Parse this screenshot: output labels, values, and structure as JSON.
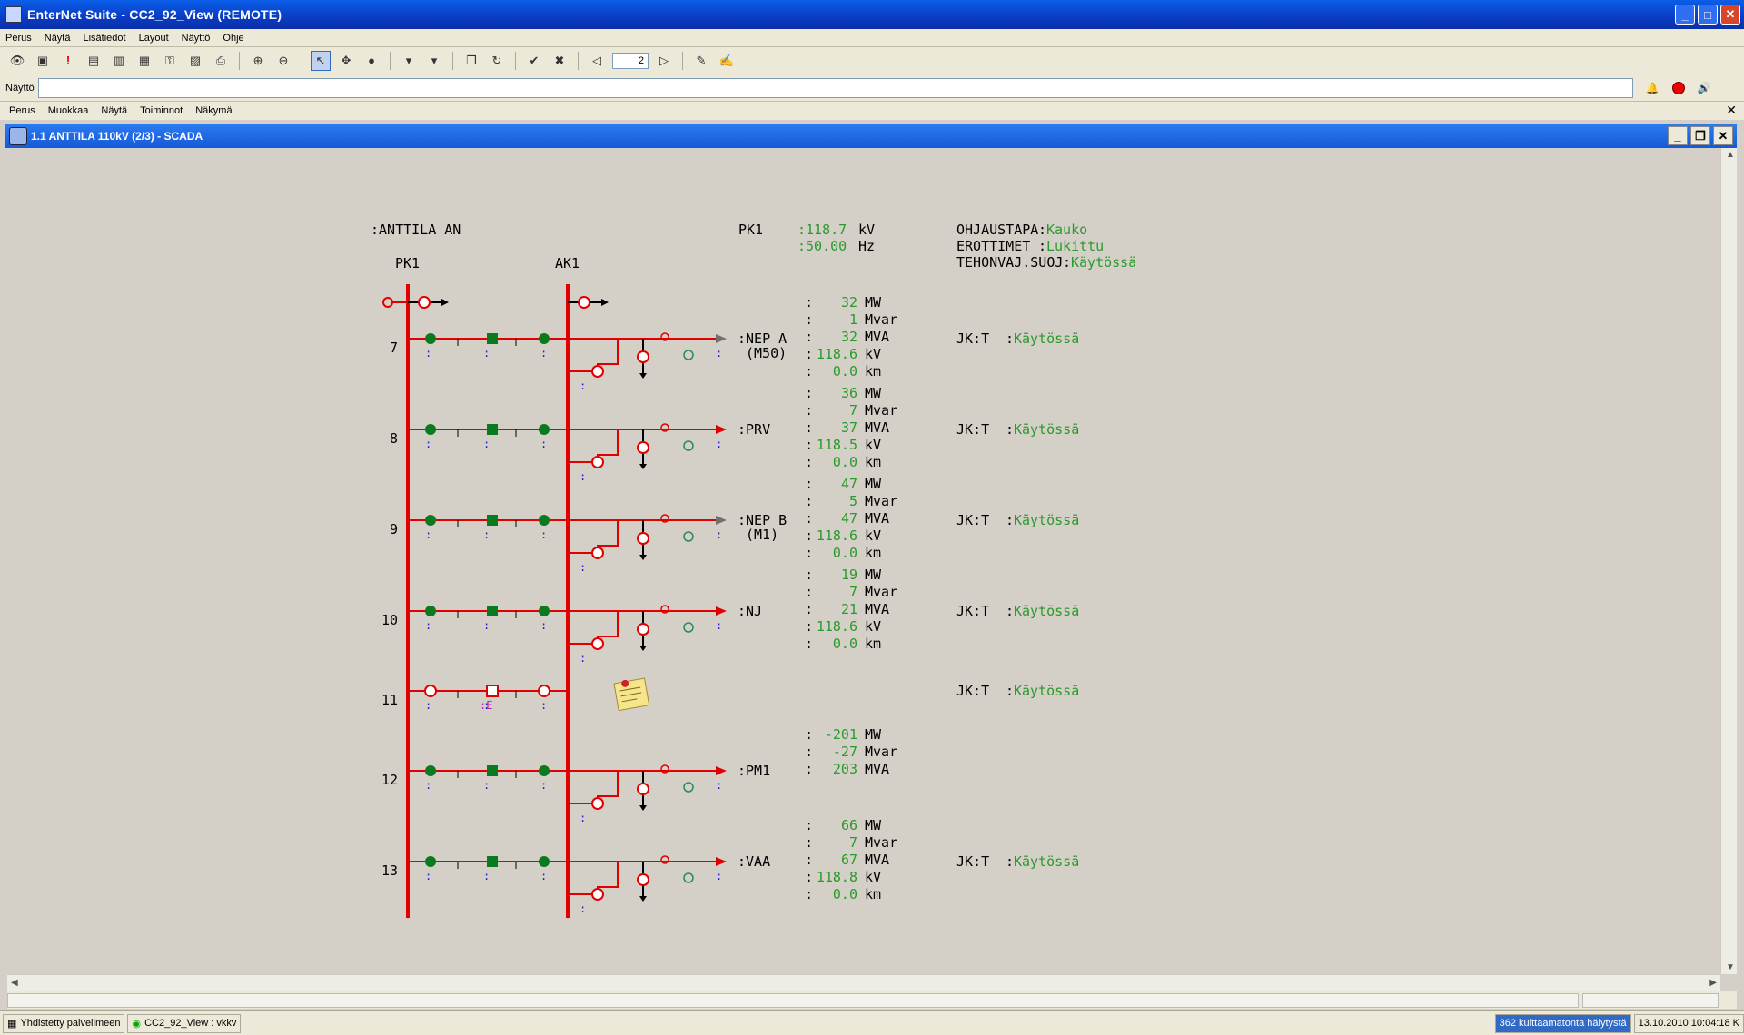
{
  "app": {
    "title": "EnterNet Suite  - CC2_92_View  (REMOTE)",
    "menu": [
      "Perus",
      "Näytä",
      "Lisätiedot",
      "Layout",
      "Näyttö",
      "Ohje"
    ],
    "command_label": "Näyttö",
    "command_value": "",
    "page_number": "2",
    "submenu": [
      "Perus",
      "Muokkaa",
      "Näytä",
      "Toiminnot",
      "Näkymä"
    ]
  },
  "child_window": {
    "title": "1.1 ANTTILA 110kV (2/3) - SCADA"
  },
  "scada": {
    "station": ":ANTTILA AN",
    "bus1": "PK1",
    "bus2": "AK1",
    "bus_meas_label": "PK1",
    "bus_kv": ":118.7",
    "bus_kv_unit": "kV",
    "bus_hz": ":50.00",
    "bus_hz_unit": "Hz",
    "status": [
      {
        "label": "OHJAUSTAPA",
        "sep": ":",
        "value": "Kauko"
      },
      {
        "label": "EROTTIMET ",
        "sep": ":",
        "value": "Lukittu"
      },
      {
        "label": "TEHONVAJ.SUOJ",
        "sep": ":",
        "value": "Käytössä"
      }
    ],
    "feeders": [
      {
        "num": "7",
        "name": ":NEP A",
        "name2": "(M50)",
        "mw": "32",
        "mvar": "1",
        "mva": "32",
        "kv": "118.6",
        "km": "0.0",
        "jkt": "Käytössä",
        "arrow": "gray"
      },
      {
        "num": "8",
        "name": ":PRV",
        "name2": "",
        "mw": "36",
        "mvar": "7",
        "mva": "37",
        "kv": "118.5",
        "km": "0.0",
        "jkt": "Käytössä",
        "arrow": "red"
      },
      {
        "num": "9",
        "name": ":NEP B",
        "name2": "(M1)",
        "mw": "47",
        "mvar": "5",
        "mva": "47",
        "kv": "118.6",
        "km": "0.0",
        "jkt": "Käytössä",
        "arrow": "gray"
      },
      {
        "num": "10",
        "name": ":NJ",
        "name2": "",
        "mw": "19",
        "mvar": "7",
        "mva": "21",
        "kv": "118.6",
        "km": "0.0",
        "jkt": "Käytössä",
        "arrow": "red"
      },
      {
        "num": "11",
        "name": "",
        "name2": "",
        "mw": "",
        "mvar": "",
        "mva": "",
        "kv": "",
        "km": "",
        "jkt": "Käytössä",
        "arrow": "none",
        "earth_label": ":E"
      },
      {
        "num": "12",
        "name": ":PM1",
        "name2": "",
        "mw": "-201",
        "mvar": "-27",
        "mva": "203",
        "kv": "",
        "km": "",
        "jkt": "",
        "arrow": "red"
      },
      {
        "num": "13",
        "name": ":VAA",
        "name2": "",
        "mw": "66",
        "mvar": "7",
        "mva": "67",
        "kv": "118.8",
        "km": "0.0",
        "jkt": "Käytössä",
        "arrow": "red"
      }
    ],
    "units": {
      "mw": "MW",
      "mvar": "Mvar",
      "mva": "MVA",
      "kv": "kV",
      "km": "km"
    },
    "jkt_label": "JK:T",
    "colors": {
      "bus": "#e00000",
      "closed": "#0a7a1e",
      "value": "#2a9a2a",
      "dots": "#2020d0",
      "text": "#000000"
    }
  },
  "statusbar": {
    "connected": "Yhdistetty palvelimeen",
    "view": "CC2_92_View : vkkv",
    "alarms": "362 kuittaamatonta hälytystä",
    "datetime": "13.10.2010 10:04:18 K"
  }
}
